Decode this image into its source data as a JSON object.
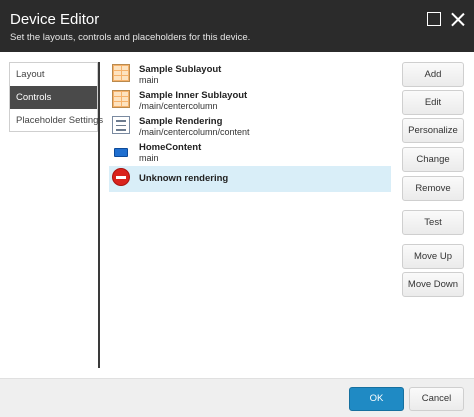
{
  "header": {
    "title": "Device Editor",
    "subtitle": "Set the layouts, controls and placeholders for this device."
  },
  "nav": [
    {
      "label": "Layout",
      "active": false
    },
    {
      "label": "Controls",
      "active": true
    },
    {
      "label": "Placeholder Settings",
      "active": false
    }
  ],
  "renderings": [
    {
      "name": "Sample Sublayout",
      "path": "main",
      "icon": "sublayout-grid-icon"
    },
    {
      "name": "Sample Inner Sublayout",
      "path": "/main/centercolumn",
      "icon": "sublayout-grid-icon"
    },
    {
      "name": "Sample Rendering",
      "path": "/main/centercolumn/content",
      "icon": "rendering-document-icon"
    },
    {
      "name": "HomeContent",
      "path": "main",
      "icon": "blue-block-icon"
    },
    {
      "name": "Unknown rendering",
      "path": "",
      "icon": "stop-icon",
      "selected": true
    }
  ],
  "actions": {
    "add": "Add",
    "edit": "Edit",
    "personalize": "Personalize",
    "change": "Change",
    "remove": "Remove",
    "test": "Test",
    "move_up": "Move Up",
    "move_down": "Move Down"
  },
  "footer": {
    "ok": "OK",
    "cancel": "Cancel"
  },
  "colors": {
    "header_bg": "#2b2b2b",
    "selected_row": "#d9eef8",
    "active_nav": "#4a4a4a",
    "ok_button": "#1f8ac4"
  }
}
